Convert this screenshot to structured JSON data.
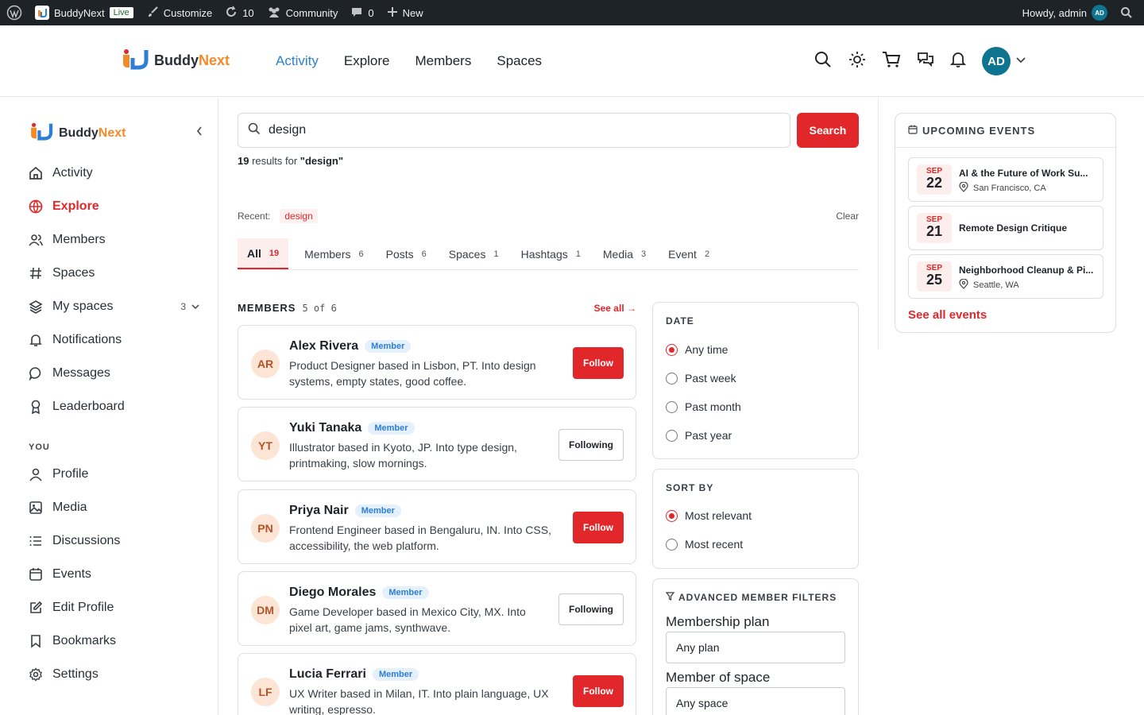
{
  "wpbar": {
    "site": "BuddyNext",
    "live": "Live",
    "customize": "Customize",
    "updates": "10",
    "community": "Community",
    "comments": "0",
    "new": "New",
    "howdy": "Howdy, admin",
    "avatar": "AD"
  },
  "brand": {
    "part1": "Buddy",
    "part2": "Next"
  },
  "header_nav": [
    "Activity",
    "Explore",
    "Members",
    "Spaces"
  ],
  "user_avatar": "AD",
  "sidebar": {
    "items": [
      {
        "label": "Activity"
      },
      {
        "label": "Explore"
      },
      {
        "label": "Members"
      },
      {
        "label": "Spaces"
      },
      {
        "label": "My spaces",
        "count": "3"
      },
      {
        "label": "Notifications"
      },
      {
        "label": "Messages"
      },
      {
        "label": "Leaderboard"
      }
    ],
    "you_heading": "YOU",
    "you_items": [
      {
        "label": "Profile"
      },
      {
        "label": "Media"
      },
      {
        "label": "Discussions"
      },
      {
        "label": "Events"
      },
      {
        "label": "Edit Profile"
      },
      {
        "label": "Bookmarks"
      },
      {
        "label": "Settings"
      }
    ]
  },
  "search": {
    "value": "design",
    "button": "Search",
    "count": "19",
    "results_text": "results for",
    "query_quoted": "\"design\""
  },
  "recent": {
    "label": "Recent:",
    "tag": "design",
    "clear": "Clear"
  },
  "tabs": [
    {
      "label": "All",
      "count": "19"
    },
    {
      "label": "Members",
      "count": "6"
    },
    {
      "label": "Posts",
      "count": "6"
    },
    {
      "label": "Spaces",
      "count": "1"
    },
    {
      "label": "Hashtags",
      "count": "1"
    },
    {
      "label": "Media",
      "count": "3"
    },
    {
      "label": "Event",
      "count": "2"
    }
  ],
  "members_section": {
    "title": "MEMBERS",
    "sub": "5 of 6",
    "see_all": "See all"
  },
  "members": [
    {
      "initials": "AR",
      "name": "Alex Rivera",
      "badge": "Member",
      "desc": "Product Designer based in Lisbon, PT. Into design systems, empty states, good coffee.",
      "action": "Follow"
    },
    {
      "initials": "YT",
      "name": "Yuki Tanaka",
      "badge": "Member",
      "desc": "Illustrator based in Kyoto, JP. Into type design, printmaking, slow mornings.",
      "action": "Following"
    },
    {
      "initials": "PN",
      "name": "Priya Nair",
      "badge": "Member",
      "desc": "Frontend Engineer based in Bengaluru, IN. Into CSS, accessibility, the web platform.",
      "action": "Follow"
    },
    {
      "initials": "DM",
      "name": "Diego Morales",
      "badge": "Member",
      "desc": "Game Developer based in Mexico City, MX. Into pixel art, game jams, synthwave.",
      "action": "Following"
    },
    {
      "initials": "LF",
      "name": "Lucia Ferrari",
      "badge": "Member",
      "desc": "UX Writer based in Milan, IT. Into plain language, UX writing, espresso.",
      "action": "Follow"
    }
  ],
  "filters": {
    "date_title": "DATE",
    "date_options": [
      "Any time",
      "Past week",
      "Past month",
      "Past year"
    ],
    "sort_title": "SORT BY",
    "sort_options": [
      "Most relevant",
      "Most recent"
    ],
    "adv_title": "ADVANCED MEMBER FILTERS",
    "plan_label": "Membership plan",
    "plan_value": "Any plan",
    "space_label": "Member of space",
    "space_value": "Any space"
  },
  "events": {
    "title": "UPCOMING EVENTS",
    "items": [
      {
        "month": "SEP",
        "day": "22",
        "title": "AI & the Future of Work Su...",
        "location": "San Francisco, CA"
      },
      {
        "month": "SEP",
        "day": "21",
        "title": "Remote Design Critique",
        "location": ""
      },
      {
        "month": "SEP",
        "day": "25",
        "title": "Neighborhood Cleanup & Pi...",
        "location": "Seattle, WA"
      }
    ],
    "see_all": "See all events"
  },
  "colors": {
    "accent": "#e2272b",
    "nav_active": "#2d7fd6",
    "brand_orange": "#f28c28",
    "avatar": "#0e7490"
  }
}
